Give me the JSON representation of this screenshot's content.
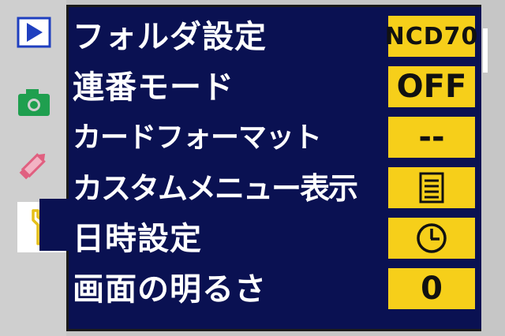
{
  "menu": {
    "items": [
      {
        "label": "フォルダ設定",
        "value": "NCD70",
        "value_type": "text"
      },
      {
        "label": "連番モード",
        "value": "OFF",
        "value_type": "text"
      },
      {
        "label": "カードフォーマット",
        "value": "--",
        "value_type": "text"
      },
      {
        "label": "カスタムメニュー表示",
        "value": "",
        "value_type": "icon",
        "icon": "list-icon"
      },
      {
        "label": "日時設定",
        "value": "",
        "value_type": "icon",
        "icon": "clock-icon"
      },
      {
        "label": "画面の明るさ",
        "value": "0",
        "value_type": "text"
      }
    ]
  },
  "tabs": [
    {
      "name": "playback-tab",
      "icon": "play-icon",
      "color": "#1f3fbf"
    },
    {
      "name": "shooting-tab",
      "icon": "camera-icon",
      "color": "#1f9f4f"
    },
    {
      "name": "custom-settings-tab",
      "icon": "pencil-icon",
      "color": "#e06080"
    },
    {
      "name": "setup-tab",
      "icon": "wrench-icon",
      "color": "#e6c01a",
      "selected": true
    }
  ],
  "colors": {
    "panel": "#0a1152",
    "value_bg": "#f6cf1a",
    "label_text": "#ffffff"
  }
}
